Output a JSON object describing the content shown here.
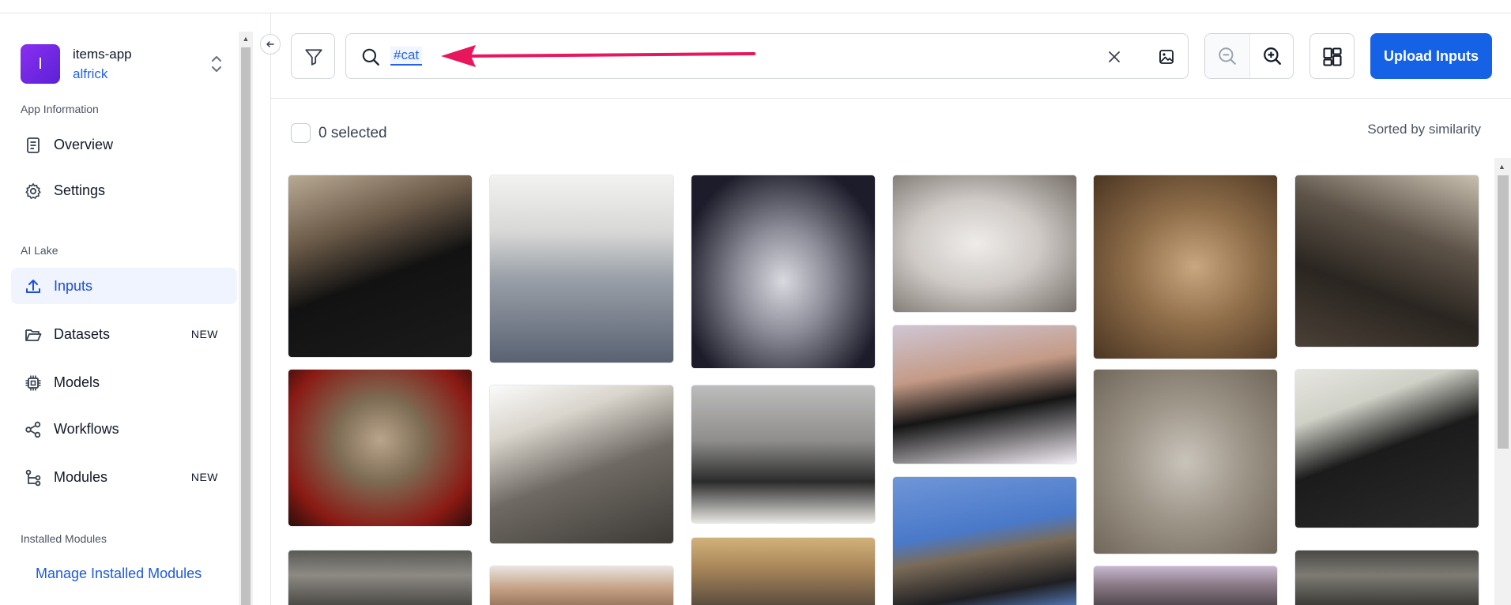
{
  "app": {
    "avatar_letter": "I",
    "name": "items-app",
    "user": "alfrick"
  },
  "sidebar": {
    "section_app_info": "App Information",
    "overview": "Overview",
    "settings": "Settings",
    "section_ai_lake": "AI Lake",
    "inputs": "Inputs",
    "datasets": "Datasets",
    "datasets_badge": "NEW",
    "models": "Models",
    "workflows": "Workflows",
    "modules": "Modules",
    "modules_badge": "NEW",
    "section_installed": "Installed Modules",
    "manage_installed": "Manage Installed Modules"
  },
  "toolbar": {
    "search_tag": "#cat",
    "upload_label": "Upload Inputs"
  },
  "content": {
    "selected_label": "0 selected",
    "sort_label": "Sorted by similarity"
  },
  "colors": {
    "brand_blue": "#1662e6",
    "active_nav_bg": "#eff4ff",
    "avatar_purple": "#7c28e8",
    "annotation_arrow": "#e8175d"
  },
  "icons": {
    "collapse": "arrow-left-icon",
    "filter": "funnel-icon",
    "search": "search-icon",
    "clear": "close-icon",
    "image_search": "image-icon",
    "zoom_out": "zoom-out-icon",
    "zoom_in": "zoom-in-icon",
    "layout": "grid-layout-icon"
  },
  "gallery": {
    "image_count": 18,
    "subject": "cat photos"
  }
}
